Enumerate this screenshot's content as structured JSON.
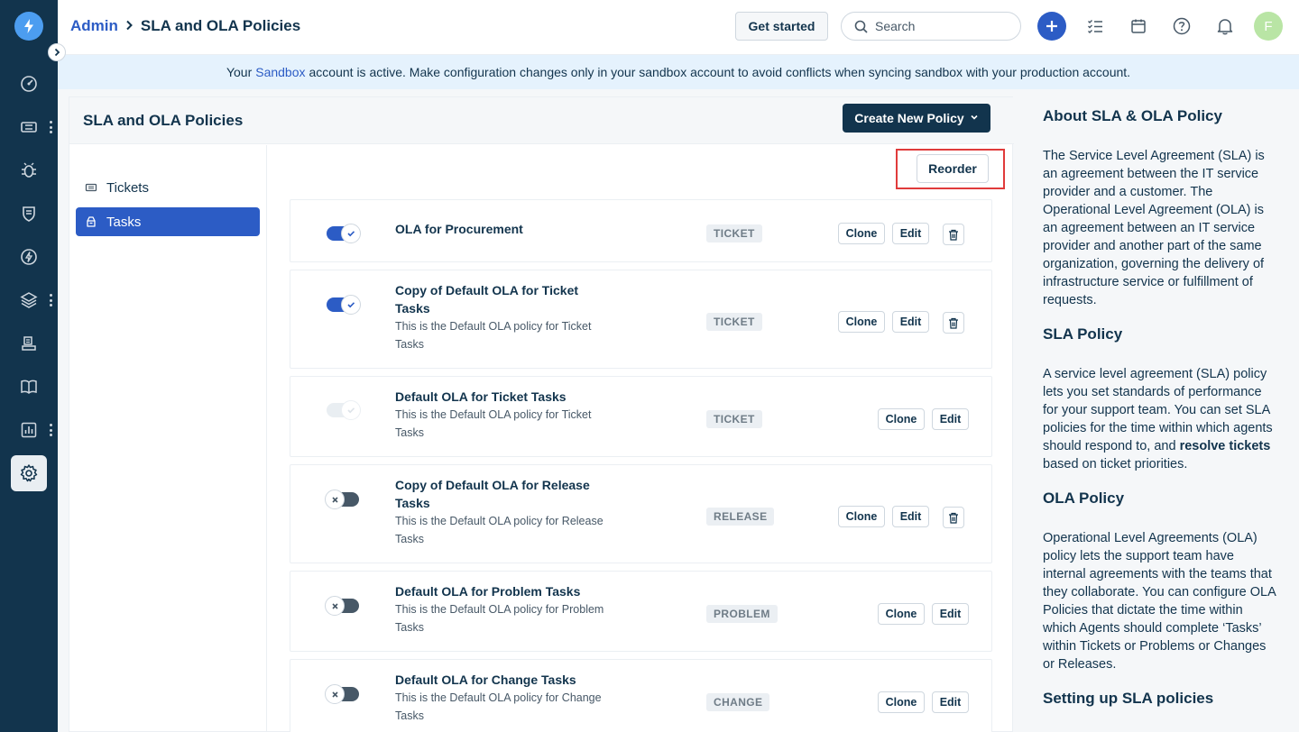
{
  "header": {
    "breadcrumb_root": "Admin",
    "page": "SLA and OLA Policies",
    "get_started": "Get started",
    "search_placeholder": "Search",
    "avatar_initial": "F"
  },
  "banner": {
    "prefix": "Your",
    "link": "Sandbox",
    "suffix": "account is active. Make configuration changes only in your sandbox account to avoid conflicts when syncing sandbox with your production account."
  },
  "main": {
    "title": "SLA and OLA Policies",
    "create_button": "Create New Policy",
    "reorder": "Reorder",
    "nav": [
      {
        "label": "Tickets",
        "icon": "ticket-icon"
      },
      {
        "label": "Tasks",
        "icon": "task-icon"
      }
    ],
    "policies": [
      {
        "title": "OLA for Procurement",
        "desc": "",
        "tag": "TICKET",
        "state": "on",
        "clone": "Clone",
        "edit": "Edit",
        "deletable": true
      },
      {
        "title": "Copy of Default OLA for Ticket Tasks",
        "desc": "This is the Default OLA policy for Ticket Tasks",
        "tag": "TICKET",
        "state": "on",
        "clone": "Clone",
        "edit": "Edit",
        "deletable": true
      },
      {
        "title": "Default OLA for Ticket Tasks",
        "desc": "This is the Default OLA policy for Ticket Tasks",
        "tag": "TICKET",
        "state": "disabled",
        "clone": "Clone",
        "edit": "Edit",
        "deletable": false
      },
      {
        "title": "Copy of Default OLA for Release Tasks",
        "desc": "This is the Default OLA policy for Release Tasks",
        "tag": "RELEASE",
        "state": "off",
        "clone": "Clone",
        "edit": "Edit",
        "deletable": true
      },
      {
        "title": "Default OLA for Problem Tasks",
        "desc": "This is the Default OLA policy for Problem Tasks",
        "tag": "PROBLEM",
        "state": "off",
        "clone": "Clone",
        "edit": "Edit",
        "deletable": false
      },
      {
        "title": "Default OLA for Change Tasks",
        "desc": "This is the Default OLA policy for Change Tasks",
        "tag": "CHANGE",
        "state": "off",
        "clone": "Clone",
        "edit": "Edit",
        "deletable": false
      }
    ]
  },
  "info": {
    "about_title": "About SLA & OLA Policy",
    "about_text": "The Service Level Agreement (SLA) is an agreement between the IT service provider and a customer. The Operational Level Agreement (OLA) is an agreement between an IT service provider and another part of the same organization, governing the delivery of infrastructure service or fulfillment of requests.",
    "sla_title": "SLA Policy",
    "sla_text_1": "A service level agreement (SLA) policy lets you set standards of performance for your support team. You can set SLA policies for the time within which agents should respond to, and",
    "sla_text_bold": "resolve tickets",
    "sla_text_2": "based on ticket priorities.",
    "ola_title": "OLA Policy",
    "ola_text": "Operational Level Agreements (OLA) policy lets the support team have internal agreements with the teams that they collaborate. You can configure OLA Policies that dictate the time within which Agents should complete ‘Tasks’ within Tickets or Problems or Changes or Releases.",
    "setup_title": "Setting up SLA policies"
  },
  "colors": {
    "rail": "#12344d",
    "accent": "#2c5cc5",
    "highlight": "#e03b3b",
    "banner": "#e5f2fd"
  }
}
